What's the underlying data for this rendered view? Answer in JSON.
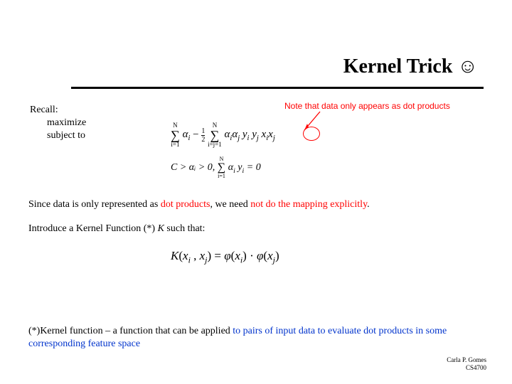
{
  "title": "Kernel Trick ☺",
  "note": "Note that data only appears as dot products",
  "recall": {
    "label": "Recall:",
    "l1": "maximize",
    "l2": "subject to"
  },
  "formula_dual": {
    "sum1_top": "N",
    "sum1_bot": "i=1",
    "sum2_top": "N",
    "sum2_bot": "i=j=1",
    "terms": "αᵢαⱼ yᵢ yⱼ",
    "xterm": "xᵢxⱼ"
  },
  "formula_constraint": {
    "left": "C > αᵢ > 0,",
    "sum_top": "N",
    "sum_bot": "i=1",
    "right": "αᵢ yᵢ = 0"
  },
  "para1": {
    "a": "Since data is only represented as ",
    "b": "dot products",
    "c": ", we need ",
    "d": "not do the mapping explicitly",
    "e": "."
  },
  "para2": {
    "a": "Introduce a Kernel Function (*) ",
    "k": "K",
    "b": " such that:"
  },
  "formula_kernel": "K ( xᵢ , xⱼ ) = φ( xᵢ ) · φ( xⱼ )",
  "footnote": {
    "a": "(*)Kernel function – a function that can be applied ",
    "b": "to pairs of input data to evaluate dot products in some corresponding feature space"
  },
  "author": {
    "name": "Carla P. Gomes",
    "course": "CS4700"
  }
}
